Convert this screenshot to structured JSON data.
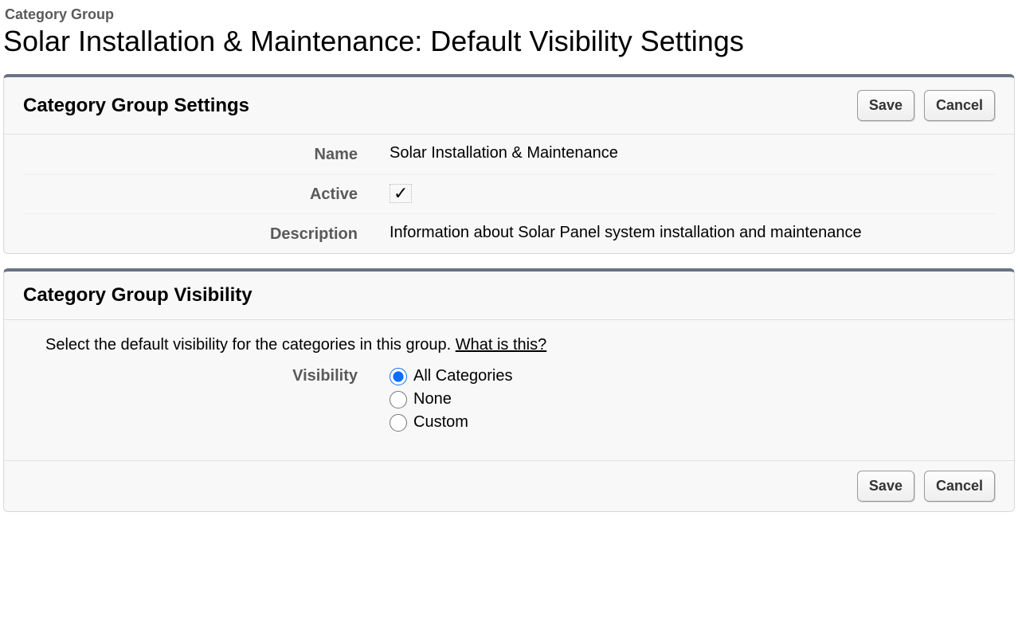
{
  "page": {
    "label": "Category Group",
    "title": "Solar Installation & Maintenance: Default Visibility Settings"
  },
  "settings_panel": {
    "heading": "Category Group Settings",
    "save_label": "Save",
    "cancel_label": "Cancel",
    "fields": {
      "name_label": "Name",
      "name_value": "Solar Installation & Maintenance",
      "active_label": "Active",
      "active_value": true,
      "description_label": "Description",
      "description_value": "Information about Solar Panel system installation and maintenance"
    }
  },
  "visibility_panel": {
    "heading": "Category Group Visibility",
    "intro_text": "Select the default visibility for the categories in this group. ",
    "intro_link": "What is this?",
    "field_label": "Visibility",
    "options": [
      {
        "label": "All Categories",
        "value": "all",
        "checked": true
      },
      {
        "label": "None",
        "value": "none",
        "checked": false
      },
      {
        "label": "Custom",
        "value": "custom",
        "checked": false
      }
    ],
    "save_label": "Save",
    "cancel_label": "Cancel"
  }
}
